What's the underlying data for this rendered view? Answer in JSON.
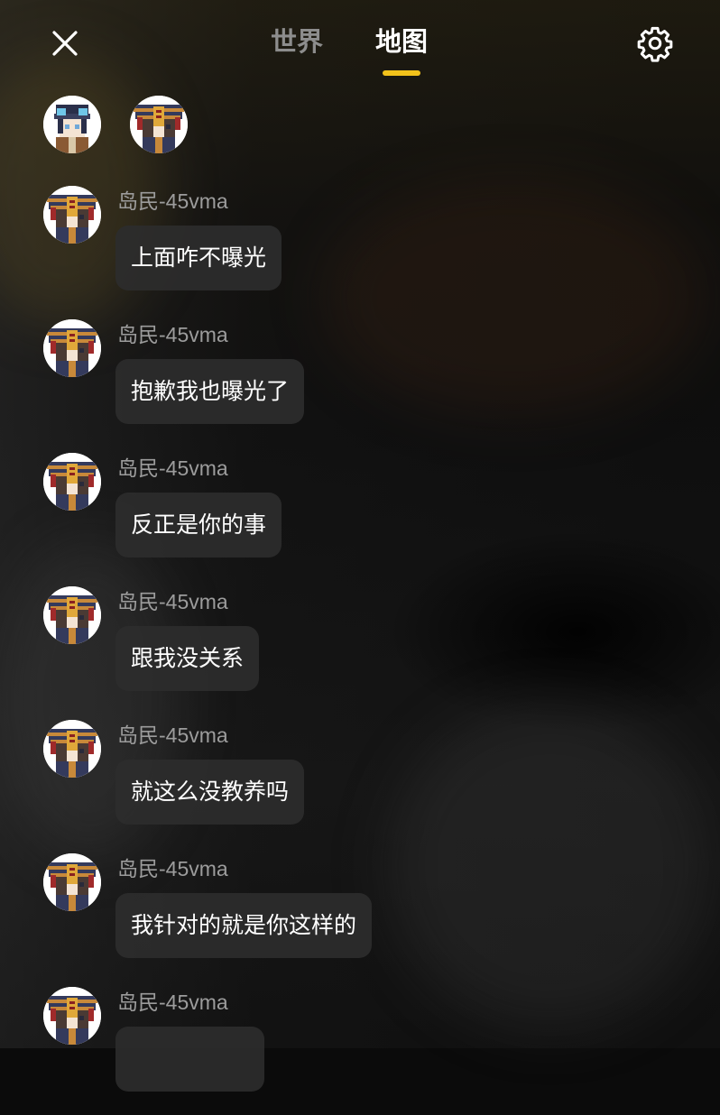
{
  "header": {
    "close_icon": "close-icon",
    "tabs": [
      {
        "label": "世界",
        "active": false
      },
      {
        "label": "地图",
        "active": true
      }
    ],
    "settings_icon": "gear-icon",
    "accent_color": "#f2c21b"
  },
  "online_users": [
    {
      "avatar": "goggles-character-avatar"
    },
    {
      "avatar": "hat-character-avatar"
    }
  ],
  "messages": [
    {
      "user": "岛民-45vma",
      "text": "上面咋不曝光"
    },
    {
      "user": "岛民-45vma",
      "text": "抱歉我也曝光了"
    },
    {
      "user": "岛民-45vma",
      "text": "反正是你的事"
    },
    {
      "user": "岛民-45vma",
      "text": "跟我没关系"
    },
    {
      "user": "岛民-45vma",
      "text": "就这么没教养吗"
    },
    {
      "user": "岛民-45vma",
      "text": "我针对的就是你这样的"
    },
    {
      "user": "岛民-45vma",
      "text": ""
    }
  ]
}
